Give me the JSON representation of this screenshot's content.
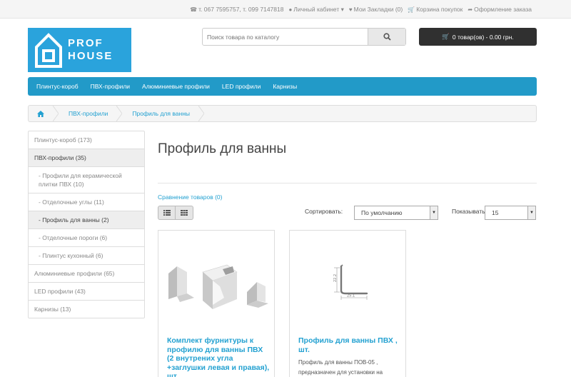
{
  "topbar": {
    "phone": "т. 067 7595757, т. 099 7147818",
    "account": "Личный кабинет",
    "wishlist": "Мои Закладки (0)",
    "cart": "Корзина покупок",
    "checkout": "Оформление заказа"
  },
  "logo": {
    "line1": "PROF",
    "line2": "HOUSE"
  },
  "search": {
    "placeholder": "Поиск товара по каталогу"
  },
  "cart_button": "0 товар(ов) - 0.00 грн.",
  "menu": [
    "Плинтус-короб",
    "ПВХ-профили",
    "Алюминиевые профили",
    "LED профили",
    "Карнизы"
  ],
  "breadcrumb": [
    "ПВХ-профили",
    "Профиль для ванны"
  ],
  "sidebar": [
    "Плинтус-короб (173)",
    "ПВХ-профили (35)",
    "- Профили для керамической плитки ПВХ (10)",
    "- Отделочные углы (11)",
    "- Профиль для ванны (2)",
    "- Отделочные пороги (6)",
    "- Плинтус кухонный (6)",
    "Алюминиевые профили (65)",
    "LED профили (43)",
    "Карнизы (13)"
  ],
  "page_title": "Профиль для ванны",
  "compare": "Сравнение товаров (0)",
  "sort": {
    "label": "Сортировать:",
    "value": "По умолчанию"
  },
  "limit": {
    "label": "Показывать:",
    "value": "15"
  },
  "products": [
    {
      "name": "Комплект фурнитуры к профилю для ванны ПВХ (2 внутрених угла +заглушки левая и правая), шт.",
      "desc": ""
    },
    {
      "name": "Профиль для ванны ПВХ , шт.",
      "desc": "Профиль для ванны ПОВ-05 , предназначен для установки на",
      "dim_a": "22.2",
      "dim_b": "25.1"
    }
  ]
}
